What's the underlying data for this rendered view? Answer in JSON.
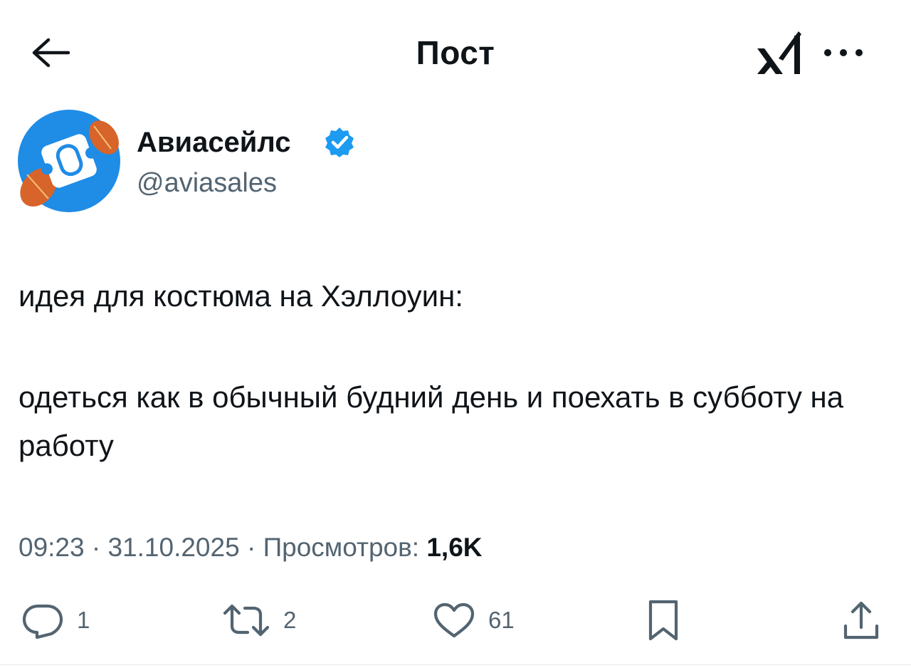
{
  "header": {
    "title": "Пост",
    "back_icon": "arrow-left-icon",
    "grok_icon": "grok-logo-icon",
    "more_icon": "more-horizontal-icon"
  },
  "author": {
    "name": "Авиасейлс",
    "handle": "@aviasales",
    "verified": true,
    "verified_color": "#1d9bf0",
    "avatar_color": "#1f8ce6"
  },
  "post": {
    "lines": [
      "идея для костюма на Хэллоуин:",
      "одеться как в обычный будний день и поехать в субботу на работу"
    ]
  },
  "meta": {
    "time": "09:23",
    "date": "31.10.2025",
    "views_label": "Просмотров:",
    "views_count": "1,6K"
  },
  "actions": {
    "replies": "1",
    "reposts": "2",
    "likes": "61"
  }
}
